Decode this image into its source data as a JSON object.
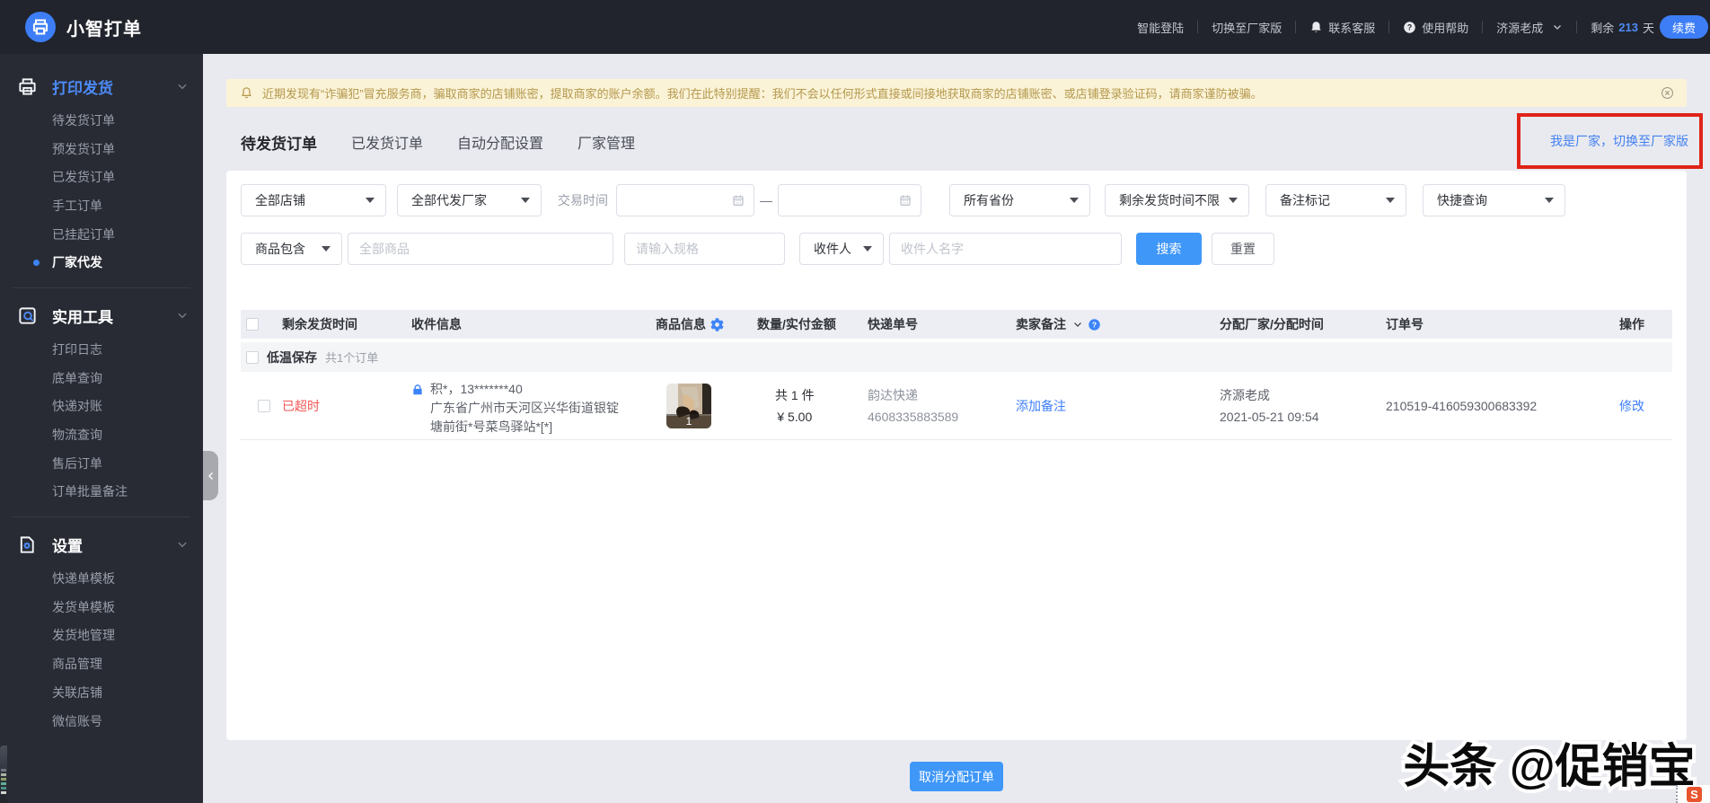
{
  "app": {
    "title": "小智打单"
  },
  "topbar": {
    "smart_login": "智能登陆",
    "switch_factory": "切换至厂家版",
    "contact_service": "联系客服",
    "help": "使用帮助",
    "username": "济源老成",
    "remain_prefix": "剩余",
    "remain_days": "213",
    "remain_suffix": "天",
    "renew_label": "续费"
  },
  "sidebar": {
    "sections": [
      {
        "title": "打印发货",
        "items": [
          {
            "label": "待发货订单"
          },
          {
            "label": "预发货订单"
          },
          {
            "label": "已发货订单"
          },
          {
            "label": "手工订单"
          },
          {
            "label": "已挂起订单"
          },
          {
            "label": "厂家代发",
            "active": true
          }
        ]
      },
      {
        "title": "实用工具",
        "items": [
          {
            "label": "打印日志"
          },
          {
            "label": "底单查询"
          },
          {
            "label": "快递对账"
          },
          {
            "label": "物流查询"
          },
          {
            "label": "售后订单"
          },
          {
            "label": "订单批量备注"
          }
        ]
      },
      {
        "title": "设置",
        "items": [
          {
            "label": "快递单模板"
          },
          {
            "label": "发货单模板"
          },
          {
            "label": "发货地管理"
          },
          {
            "label": "商品管理"
          },
          {
            "label": "关联店铺"
          },
          {
            "label": "微信账号"
          }
        ]
      }
    ]
  },
  "notice": {
    "text": "近期发现有“诈骗犯”冒充服务商，骗取商家的店铺账密，提取商家的账户余额。我们在此特别提醒：我们不会以任何形式直接或间接地获取商家的店铺账密、或店铺登录验证码，请商家谨防被骗。"
  },
  "tabs": [
    {
      "label": "待发货订单",
      "active": true
    },
    {
      "label": "已发货订单"
    },
    {
      "label": "自动分配设置"
    },
    {
      "label": "厂家管理"
    }
  ],
  "switch_link": "我是厂家，切换至厂家版",
  "filters": {
    "shop_select": "全部店铺",
    "factory_select": "全部代发厂家",
    "trade_time_label": "交易时间",
    "date_separator": "—",
    "province_select": "所有省份",
    "remain_time_select": "剩余发货时间不限",
    "note_mark_select": "备注标记",
    "quick_query_select": "快捷查询",
    "product_contains_select": "商品包含",
    "product_placeholder": "全部商品",
    "spec_placeholder": "请输入规格",
    "receiver_select": "收件人",
    "receiver_placeholder": "收件人名字",
    "search_button": "搜索",
    "reset_button": "重置"
  },
  "table": {
    "columns": {
      "c1": "剩余发货时间",
      "c2": "收件信息",
      "c3": "商品信息",
      "c4": "数量/实付金额",
      "c5": "快递单号",
      "c6": "卖家备注",
      "c7": "分配厂家/分配时间",
      "c8": "订单号",
      "c9": "操作"
    },
    "group": {
      "title": "低温保存",
      "count": "共1个订单"
    },
    "row": {
      "status": "已超时",
      "receiver": "积*，13*******40",
      "address_line1": "广东省广州市天河区兴华街道银锭",
      "address_line2": "塘前街*号菜鸟驿站*[*]",
      "qty_badge": "1",
      "qty": "共 1 件",
      "amount": "¥ 5.00",
      "courier": "韵达快递",
      "tracking_no": "4608335883589",
      "add_note_link": "添加备注",
      "factory": "济源老成",
      "assign_time": "2021-05-21 09:54",
      "order_no": "210519-416059300683392",
      "action": "修改"
    }
  },
  "footer": {
    "cancel_button": "取消分配订单"
  },
  "watermark": "头条 @促销宝",
  "corner_tool_label": "S",
  "colors": {
    "primary_blue": "#3d84f8",
    "link_blue": "#3d7ffc",
    "status_red": "#f25555",
    "annotation_red": "#e02318",
    "notice_gold": "#b4984d",
    "topbar_dark": "#21242c",
    "sidebar_dark": "#282b34"
  }
}
